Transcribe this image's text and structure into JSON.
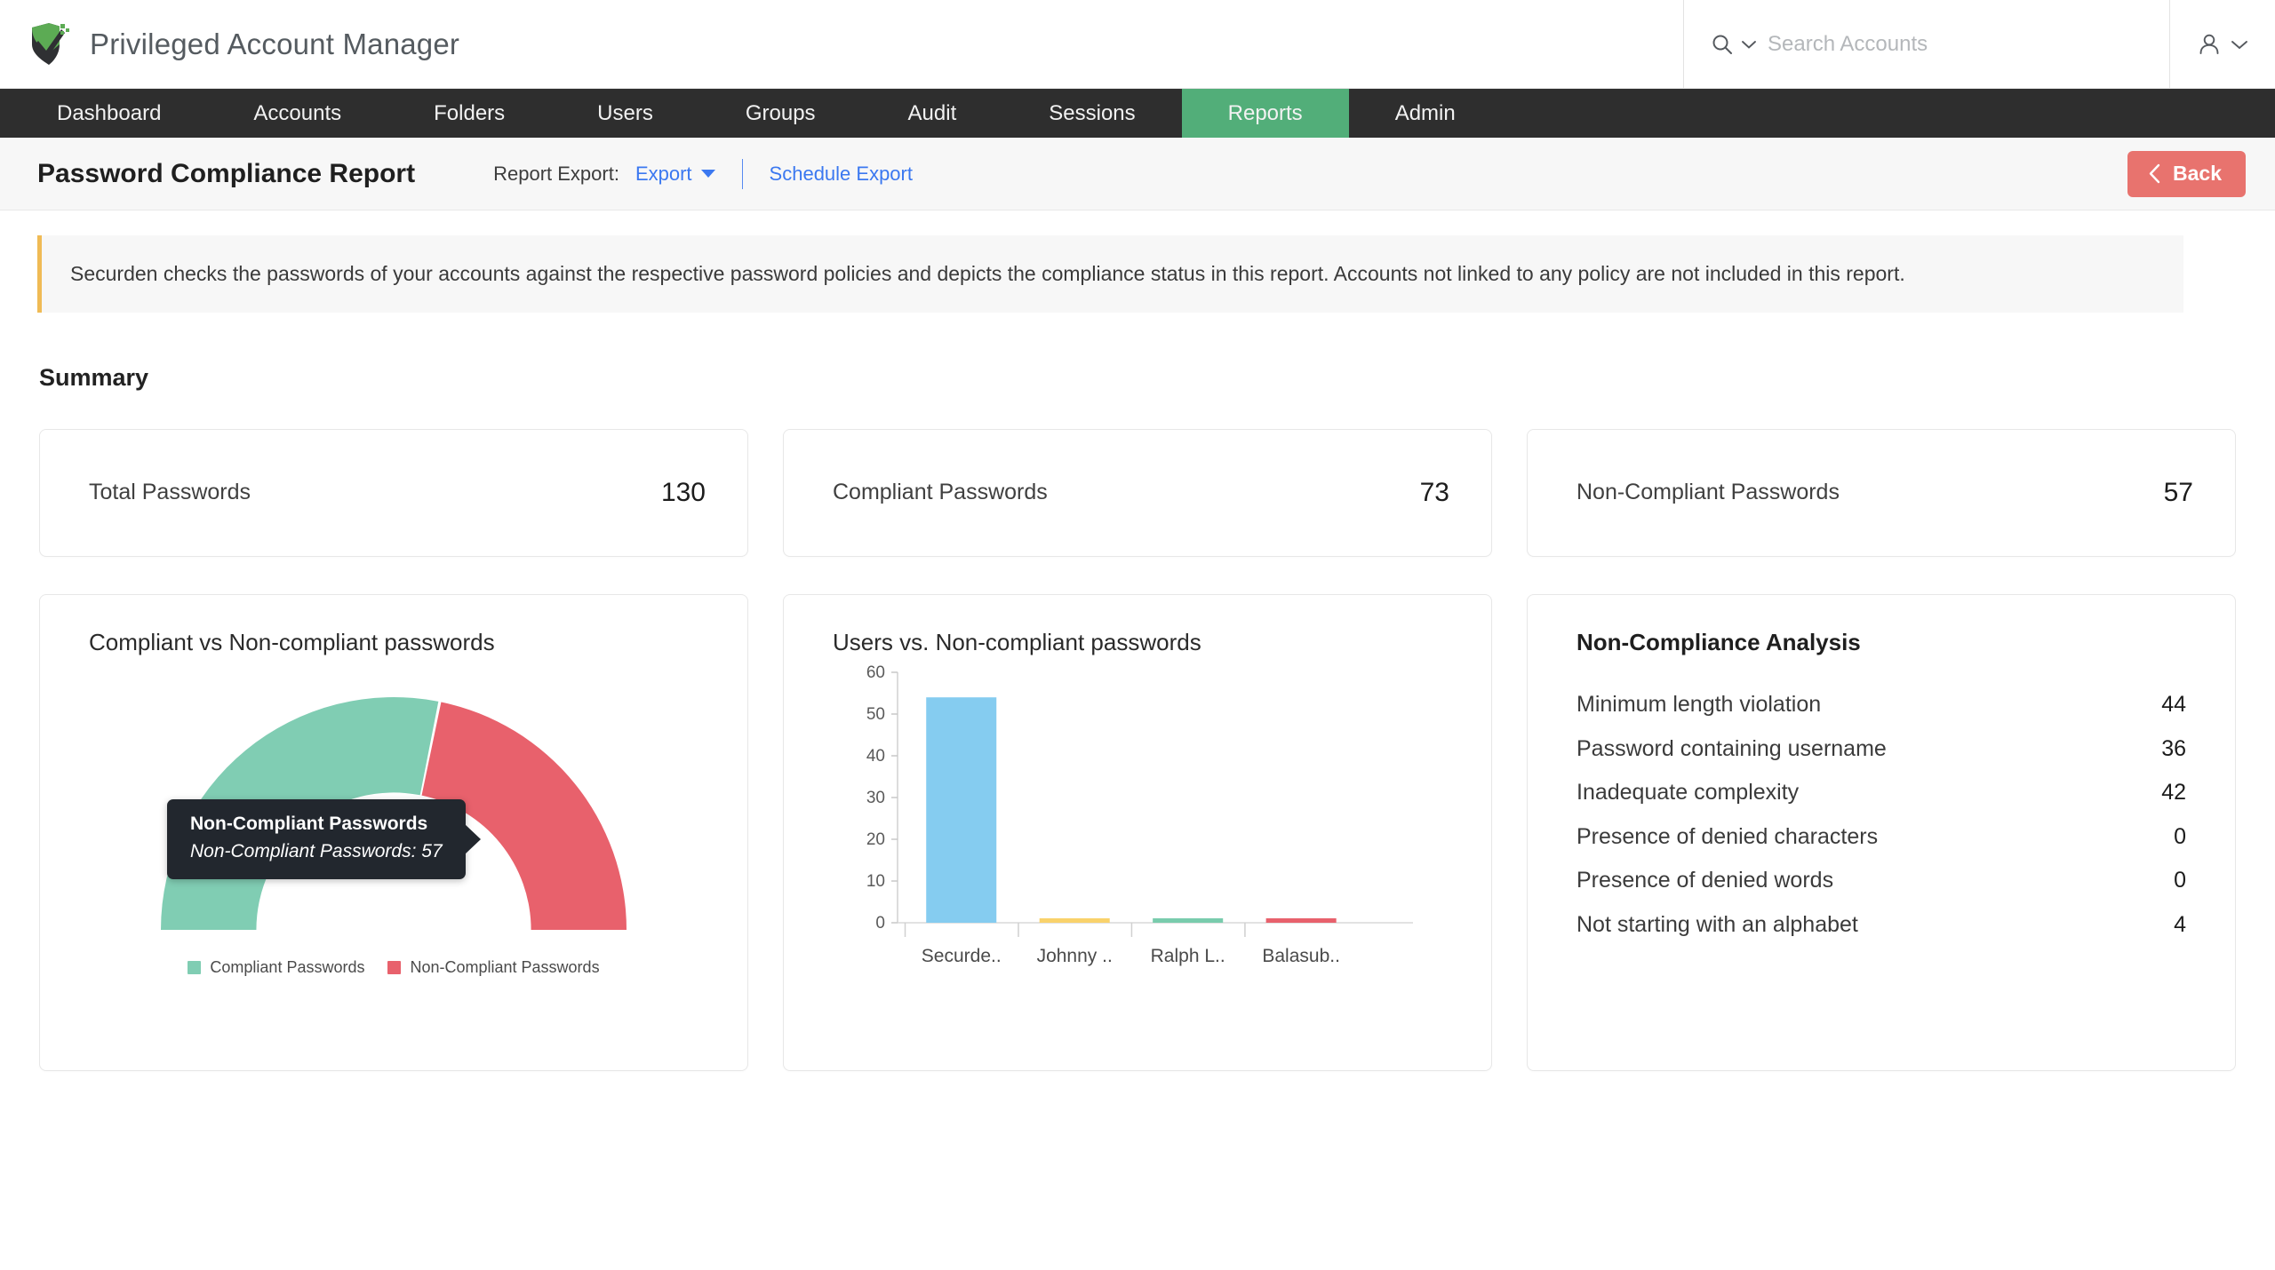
{
  "header": {
    "brand_title": "Privileged Account Manager",
    "logo_icon": "shield-check-logo",
    "search": {
      "placeholder": "Search Accounts",
      "value": "",
      "icon": "search-icon",
      "chevron_icon": "chevron-down-icon"
    },
    "user_menu": {
      "icon": "user-icon",
      "chevron_icon": "chevron-down-icon"
    }
  },
  "nav": {
    "items": [
      {
        "label": "Dashboard",
        "active": false
      },
      {
        "label": "Accounts",
        "active": false
      },
      {
        "label": "Folders",
        "active": false
      },
      {
        "label": "Users",
        "active": false
      },
      {
        "label": "Groups",
        "active": false
      },
      {
        "label": "Audit",
        "active": false
      },
      {
        "label": "Sessions",
        "active": false
      },
      {
        "label": "Reports",
        "active": true
      },
      {
        "label": "Admin",
        "active": false
      }
    ],
    "active_color": "#52ae79"
  },
  "subheader": {
    "page_title": "Password Compliance Report",
    "export_label": "Report Export:",
    "export_link": "Export",
    "schedule_link": "Schedule Export",
    "back_button": "Back",
    "back_icon": "chevron-left-icon",
    "back_color": "#e8736e",
    "link_color": "#3b78f0"
  },
  "notice": {
    "text": "Securden checks the passwords of your accounts against the respective password policies and depicts the compliance status in this report. Accounts not linked to any policy are not included in this report.",
    "accent_color": "#f0bb55"
  },
  "summary": {
    "heading": "Summary",
    "stats": [
      {
        "label": "Total Passwords",
        "value": "130"
      },
      {
        "label": "Compliant Passwords",
        "value": "73"
      },
      {
        "label": "Non-Compliant Passwords",
        "value": "57"
      }
    ]
  },
  "analysis": {
    "title": "Non-Compliance Analysis",
    "rows": [
      {
        "label": "Minimum length violation",
        "value": "44"
      },
      {
        "label": "Password containing username",
        "value": "36"
      },
      {
        "label": "Inadequate complexity",
        "value": "42"
      },
      {
        "label": "Presence of denied characters",
        "value": "0"
      },
      {
        "label": "Presence of denied words",
        "value": "0"
      },
      {
        "label": "Not starting with an alphabet",
        "value": "4"
      }
    ]
  },
  "tooltip": {
    "title": "Non-Compliant Passwords",
    "body": "Non-Compliant Passwords: 57"
  },
  "chart_data": [
    {
      "type": "pie",
      "variant": "half-donut-gauge",
      "title": "Compliant vs Non-compliant passwords",
      "labels": [
        "Compliant Passwords",
        "Non-Compliant Passwords"
      ],
      "values": [
        73,
        57
      ],
      "total": 130,
      "colors": [
        "#80cdb3",
        "#e8616c"
      ],
      "legend_position": "bottom",
      "start_angle": 180,
      "end_angle": 360,
      "inner_radius_ratio": 0.59
    },
    {
      "type": "bar",
      "title": "Users vs. Non-compliant passwords",
      "categories": [
        "Securde..",
        "Johnny ..",
        "Ralph L..",
        "Balasub.."
      ],
      "values": [
        54,
        1,
        1,
        1
      ],
      "colors": [
        "#85ccf0",
        "#f9d26b",
        "#79ccad",
        "#e8616c"
      ],
      "xlabel": "",
      "ylabel": "",
      "ylim": [
        0,
        60
      ],
      "yticks": [
        0,
        10,
        20,
        30,
        40,
        50,
        60
      ],
      "grid": false,
      "legend_position": "none"
    }
  ]
}
